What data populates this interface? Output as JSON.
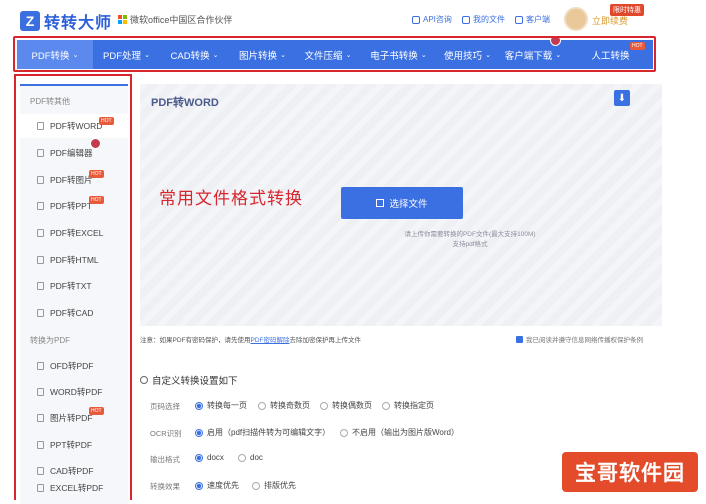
{
  "header": {
    "logo_mark": "Z",
    "logo_text": "转转大师",
    "partner_text": "微软office中国区合作伙伴",
    "links": [
      "API咨询",
      "我的文件",
      "客户端"
    ],
    "renew_text": "立即续费",
    "promo_badge": "限时特惠"
  },
  "nav": {
    "items": [
      {
        "label": "PDF转换",
        "chev": "⌄"
      },
      {
        "label": "PDF处理",
        "chev": "⌄"
      },
      {
        "label": "CAD转换",
        "chev": "⌄"
      },
      {
        "label": "图片转换",
        "chev": "⌄"
      },
      {
        "label": "文件压缩",
        "chev": "⌄"
      },
      {
        "label": "电子书转换",
        "chev": "⌄"
      },
      {
        "label": "使用技巧",
        "chev": "⌄"
      },
      {
        "label": "客户端下载",
        "chev": "⌄"
      },
      {
        "label": "人工转换",
        "chev": ""
      }
    ],
    "hot_label": "HOT"
  },
  "sidebar": {
    "section1_title": "PDF转其他",
    "section1_items": [
      "PDF转WORD",
      "PDF编辑器",
      "PDF转图片",
      "PDF转PPT",
      "PDF转EXCEL",
      "PDF转HTML",
      "PDF转TXT",
      "PDF转CAD"
    ],
    "section2_title": "转换为PDF",
    "section2_items": [
      "OFD转PDF",
      "WORD转PDF",
      "图片转PDF",
      "PPT转PDF",
      "CAD转PDF",
      "EXCEL转PDF"
    ],
    "hot_label": "HOT"
  },
  "hero": {
    "title": "PDF转WORD",
    "slogan": "常用文件格式转换",
    "button_label": "选择文件",
    "hint_line1": "请上传你需要转换的PDF文件(最大支持100M)",
    "hint_line2": "支持pdf格式",
    "download_glyph": "⬇"
  },
  "note": {
    "prefix": "注意：如果PDF有密码保护，请先使用",
    "link": "PDF密码解除",
    "suffix": "去除加密保护再上传文件"
  },
  "agreement": "我已阅读并遵守信息网络传播权保护条例",
  "settings": {
    "title": "自定义转换设置如下",
    "page_select_label": "页码选择",
    "page_options": [
      "转换每一页",
      "转换奇数页",
      "转换偶数页",
      "转换指定页"
    ],
    "ocr_label": "OCR识别",
    "ocr_options": [
      "启用（pdf扫描件转为可编辑文字）",
      "不启用（输出为图片版Word）"
    ],
    "format_label": "输出格式",
    "format_options": [
      "docx",
      "doc"
    ],
    "effect_label": "转换效果",
    "effect_options": [
      "速度优先",
      "排版优先"
    ]
  },
  "watermark": "宝哥软件园"
}
